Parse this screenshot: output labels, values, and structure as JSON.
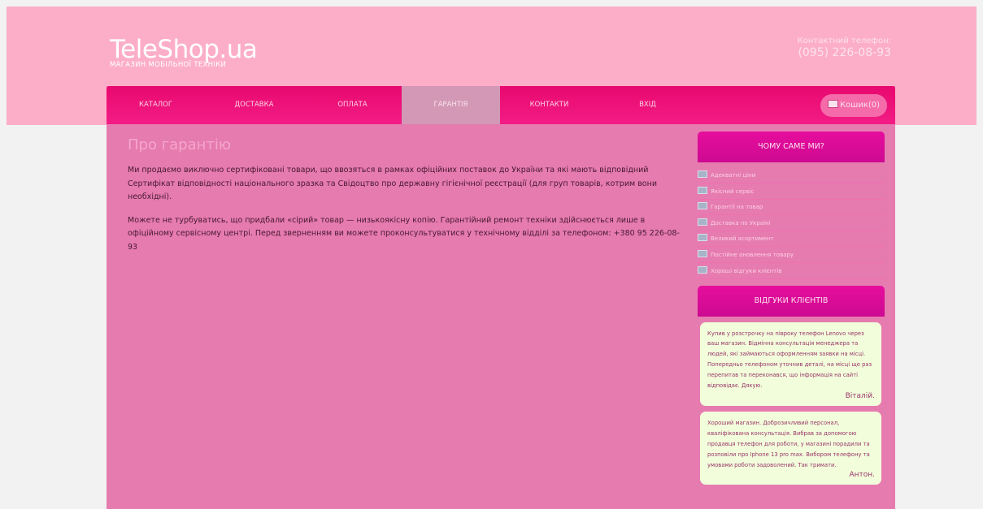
{
  "header": {
    "logo_title": "TeleShop.ua",
    "logo_subtitle": "МАГАЗИН МОБІЛЬНОЇ ТЕХНІКИ",
    "contact_label": "Контактний телефон:",
    "contact_phone": "(095) 226-08-93"
  },
  "nav": {
    "items": [
      {
        "label": "КАТАЛОГ"
      },
      {
        "label": "ДОСТАВКА"
      },
      {
        "label": "ОПЛАТА"
      },
      {
        "label": "ГАРАНТІЯ",
        "active": true
      },
      {
        "label": "КОНТАКТИ"
      },
      {
        "label": "ВХІД"
      }
    ],
    "cart_label": "Кошик(0)"
  },
  "content": {
    "title": "Про гарантію",
    "paragraphs": [
      "Ми продаємо виключно сертифіковані товари, що ввозяться в рамках офіційних поставок до України та які мають відповідний Сертифікат відповідності національного зразка та Свідоцтво про державну гігієнічної реєстрації (для груп товарів, котрим вони необхідні).",
      "Можете не турбуватись, що придбали «сірий» товар — низькоякісну копію. Гарантійний ремонт техніки здійснюється лише в офіційному сервісному центрі. Перед зверненням ви можете проконсультуватися у технічному відділі за телефоном: +380 95 226-08-93"
    ]
  },
  "sidebar": {
    "why_title": "ЧОМУ САМЕ МИ?",
    "why_items": [
      "Адекватні ціни",
      "Якісний сервіс",
      "Гарантії на товар",
      "Доставка по Україні",
      "Великий асортимент",
      "Постійне оновлення товару",
      "Хороші відгуки клієнтів"
    ],
    "reviews_title": "ВІДГУКИ КЛІЄНТІВ",
    "reviews": [
      {
        "text": "Купив у розстрочку на півроку телефон Lenovo через ваш магазин. Відмінна консультація менеджера та людей, які займаються оформленням заявки на місці. Попередньо телефоном уточнив деталі, на місці ще раз перепитав та переконався, що інформація на сайті відповідає. Дякую.",
        "author": "Віталій."
      },
      {
        "text": "Хороший магазин. Доброзичливий персонал, кваліфікована консультація. Вибрав за допомогою продавця телефон для роботи, у магазині порадили та розповіли про Iphone 13 pro max. Вибором телефону та умовами роботи задоволений. Так тримати.",
        "author": "Антон."
      }
    ]
  }
}
